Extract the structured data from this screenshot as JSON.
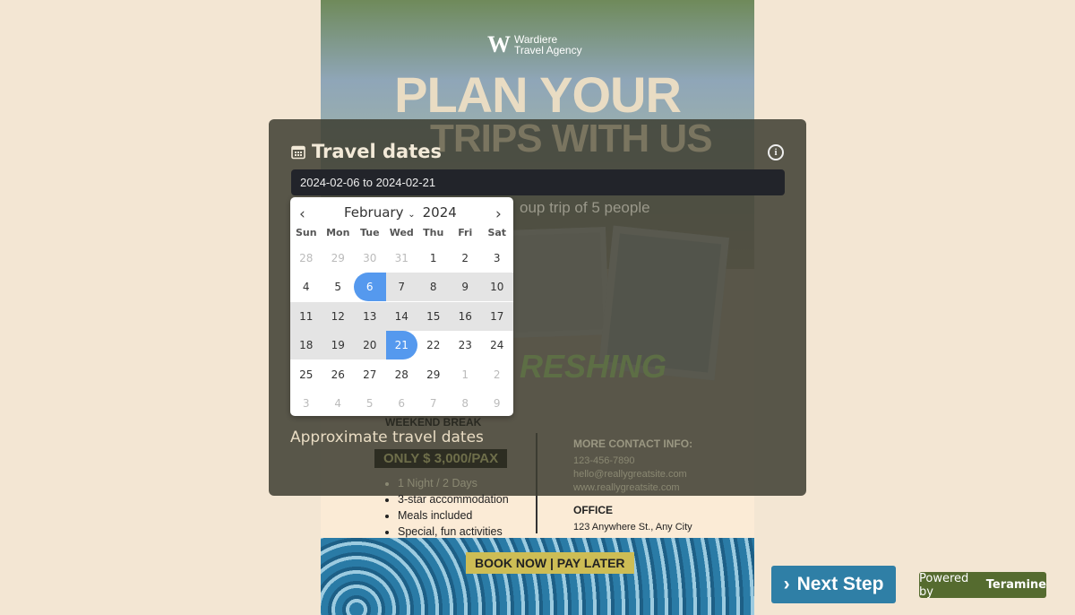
{
  "poster": {
    "logo_mark": "W",
    "logo_text_1": "Wardiere",
    "logo_text_2": "Travel Agency",
    "title_1": "PLAN YOUR",
    "title_2": "TRIPS WITH US",
    "subtitle": "oup trip of 5 people",
    "headline": "RESHING",
    "weekend": "WEEKEND BREAK",
    "price": "ONLY $ 3,000/PAX",
    "features": [
      "1 Night / 2 Days",
      "3-star accommodation",
      "Meals included",
      "Special, fun activities"
    ],
    "contact_heading": "MORE CONTACT INFO:",
    "phone": "123-456-7890",
    "email": "hello@reallygreatsite.com",
    "website": "www.reallygreatsite.com",
    "office_heading": "OFFICE",
    "office_address": "123 Anywhere St., Any City",
    "cta": "BOOK NOW | PAY LATER"
  },
  "form": {
    "title": "Travel dates",
    "title_icon": "calendar-icon",
    "info_icon": "info-icon",
    "date_value": "2024-02-06 to 2024-02-21",
    "approx_label": "Approximate travel dates"
  },
  "calendar": {
    "month": "February",
    "year": "2024",
    "weekdays": [
      "Sun",
      "Mon",
      "Tue",
      "Wed",
      "Thu",
      "Fri",
      "Sat"
    ],
    "weeks": [
      [
        "28",
        "29",
        "30",
        "31",
        "1",
        "2",
        "3"
      ],
      [
        "4",
        "5",
        "6",
        "7",
        "8",
        "9",
        "10"
      ],
      [
        "11",
        "12",
        "13",
        "14",
        "15",
        "16",
        "17"
      ],
      [
        "18",
        "19",
        "20",
        "21",
        "22",
        "23",
        "24"
      ],
      [
        "25",
        "26",
        "27",
        "28",
        "29",
        "1",
        "2"
      ],
      [
        "3",
        "4",
        "5",
        "6",
        "7",
        "8",
        "9"
      ]
    ],
    "range_start": "6",
    "range_end": "21",
    "accent": "#5599ee"
  },
  "footer": {
    "next_label": "Next Step",
    "powered_prefix": "Powered by",
    "powered_brand": "Teramine"
  }
}
